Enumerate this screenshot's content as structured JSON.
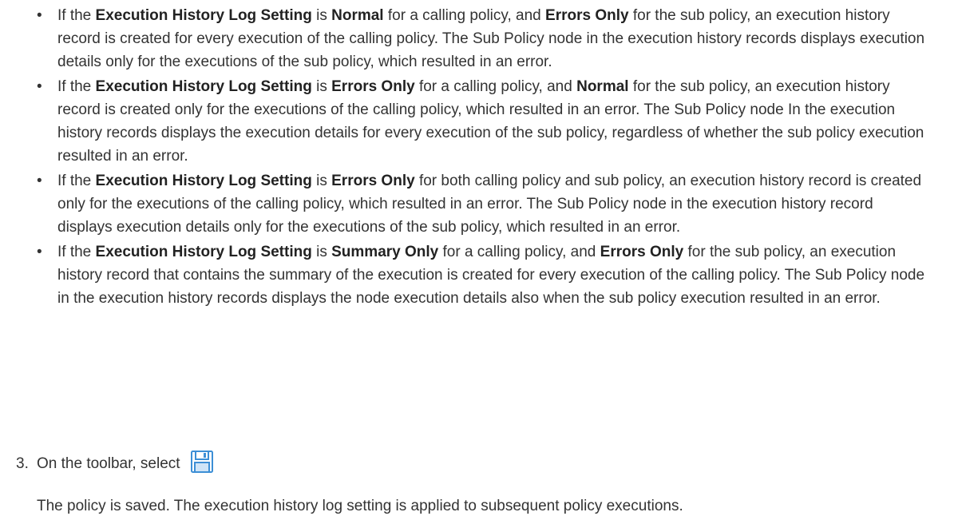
{
  "bullets": [
    {
      "pre": "If the ",
      "b1": "Execution History Log Setting",
      "mid1": " is ",
      "b2": "Normal",
      "mid2": " for a calling policy, and ",
      "b3": "Errors Only",
      "post": " for the sub policy, an execution history record is created for every execution of the calling policy. The Sub Policy node in the execution history records displays execution details only for the executions of the sub policy, which resulted in an error."
    },
    {
      "pre": "If the ",
      "b1": "Execution History Log Setting",
      "mid1": " is ",
      "b2": "Errors Only",
      "mid2": " for a calling policy, and ",
      "b3": "Normal",
      "post": " for the sub policy, an execution history record is created only for the executions of the calling policy, which resulted in an error. The Sub Policy node In the execution history records displays the execution details for every execution of the sub policy, regardless of whether the sub policy execution resulted in an error."
    },
    {
      "pre": "If the ",
      "b1": "Execution History Log Setting",
      "mid1": " is ",
      "b2": "Errors Only",
      "mid2": " for both calling policy and sub policy, an execution history record is created only for the executions of the calling policy, which resulted in an error. The Sub Policy node in the execution history record displays execution details only for the executions of the sub policy, which resulted in an error.",
      "b3": "",
      "post": ""
    },
    {
      "pre": "If the ",
      "b1": "Execution History Log Setting",
      "mid1": " is ",
      "b2": "Summary Only",
      "mid2": " for a calling policy, and ",
      "b3": "Errors Only",
      "post": " for the sub policy, an execution history record that contains the summary of the execution is created for every execution of the calling policy. The Sub Policy node in the execution history records displays the node execution details also when the sub policy execution resulted in an error."
    }
  ],
  "bullet_glyph": "•",
  "step": {
    "number": "3.",
    "text": "On the toolbar, select",
    "icon": "save-icon",
    "icon_color": "#3d8fd6"
  },
  "result": "The policy is saved. The execution history log setting is applied to subsequent policy executions."
}
